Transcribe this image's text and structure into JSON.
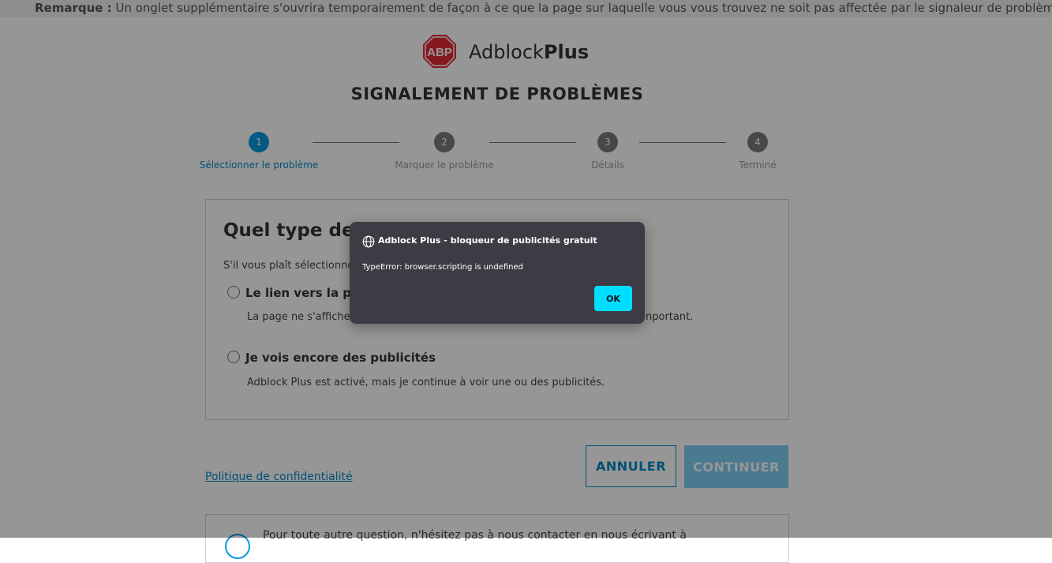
{
  "note_bar": {
    "label": "Remarque :",
    "text": "Un onglet supplémentaire s'ouvrira temporairement de façon à ce que la page sur laquelle vous vous trouvez ne soit pas affectée par le signaleur de problèmes."
  },
  "logo": {
    "badge_text": "ABP",
    "name_regular": "Adblock",
    "name_bold": "Plus"
  },
  "page_title": "SIGNALEMENT DE PROBLÈMES",
  "stepper": {
    "steps": [
      {
        "number": "1",
        "label": "Sélectionner le problème",
        "state": "active"
      },
      {
        "number": "2",
        "label": "Marquer le problème",
        "state": "inactive"
      },
      {
        "number": "3",
        "label": "Détails",
        "state": "inactive"
      },
      {
        "number": "4",
        "label": "Terminé",
        "state": "inactive"
      }
    ]
  },
  "card": {
    "title": "Quel type de pr",
    "subtitle": "S'il vous plaît sélectionnez",
    "options": [
      {
        "label": "Le lien vers la page",
        "description_start": "La page ne s'affiche pa",
        "description_end": "nportant.",
        "selected": false
      },
      {
        "label": "Je vois encore des publicités",
        "description": "Adblock Plus est activé, mais je continue à voir une ou des publicités.",
        "selected": false
      }
    ]
  },
  "footer": {
    "privacy_link": "Politique de confidentialité",
    "cancel_label": "ANNULER",
    "continue_label": "CONTINUER"
  },
  "contact": {
    "text": "Pour toute autre question, n'hésitez pas à nous contacter en nous écrivant à"
  },
  "dialog": {
    "icon": "globe-icon",
    "title": "Adblock Plus - bloqueur de publicités gratuit",
    "message": "TypeError: browser.scripting is undefined",
    "ok_label": "OK"
  },
  "colors": {
    "accent": "#0797e1",
    "link": "#0688c8",
    "logo_red": "#e42c35",
    "continue_disabled": "#7ecff3",
    "dialog_bg": "#3d3c45",
    "dialog_button": "#00ddff",
    "overlay": "rgba(0,0,0,0.41)"
  }
}
